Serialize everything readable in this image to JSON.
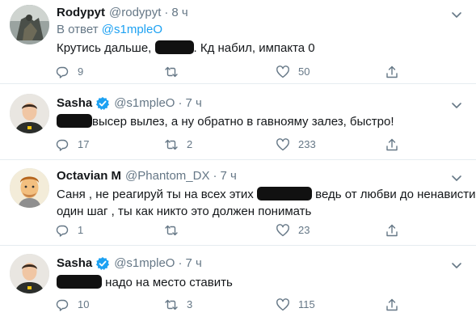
{
  "tweets": [
    {
      "name": "Rodypyt",
      "handle": "@rodypyt",
      "separator": "·",
      "time": "8 ч",
      "verified": false,
      "reply_prefix": "В ответ",
      "reply_mention": "@s1mpleO",
      "text_before": "Крутись дальше,",
      "text_after": ". Кд набил, импакта 0",
      "reply_count": "9",
      "retweet_count": "",
      "like_count": "50"
    },
    {
      "name": "Sasha",
      "handle": "@s1mpleO",
      "separator": "·",
      "time": "7 ч",
      "verified": true,
      "text_after": "высер вылез, а ну обратно в гавнояму залез, быстро!",
      "reply_count": "17",
      "retweet_count": "2",
      "like_count": "233"
    },
    {
      "name": "Octavian M",
      "handle": "@Phantom_DX",
      "separator": "·",
      "time": "7 ч",
      "verified": false,
      "text_before": "Саня , не реагируй ты на всех этих",
      "text_after": "ведь от любви до ненависти",
      "text_line2": "один шаг , ты как никто это должен понимать",
      "reply_count": "1",
      "retweet_count": "",
      "like_count": "23"
    },
    {
      "name": "Sasha",
      "handle": "@s1mpleO",
      "separator": "·",
      "time": "7 ч",
      "verified": true,
      "text_after": "надо на место ставить",
      "reply_count": "10",
      "retweet_count": "3",
      "like_count": "115"
    }
  ],
  "icons": {
    "reply": "reply-icon",
    "retweet": "retweet-icon",
    "like": "heart-icon",
    "share": "share-icon",
    "verified": "verified-badge-icon",
    "caret": "chevron-down-icon"
  },
  "colors": {
    "link": "#1da1f2",
    "muted": "#657786",
    "verified": "#1da1f2",
    "divider": "#e6ecf0"
  }
}
